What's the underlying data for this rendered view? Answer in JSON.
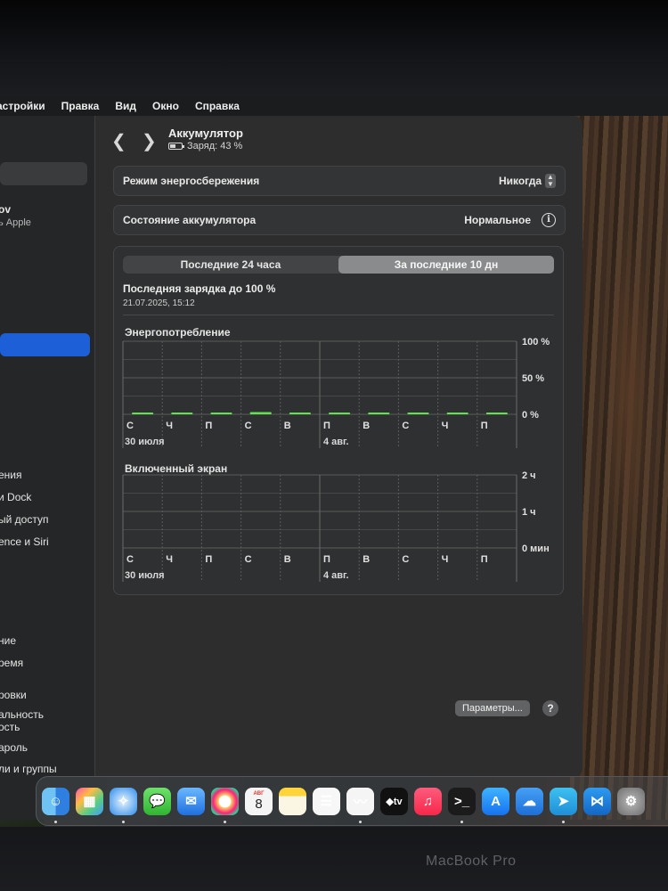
{
  "menubar": {
    "items": [
      "астройки",
      "Правка",
      "Вид",
      "Окно",
      "Справка"
    ]
  },
  "sidebar": {
    "user_name": "ov",
    "user_sub": "ь Apple",
    "items": [
      "ения",
      "и Dock",
      "ый доступ",
      "ence и Siri",
      "ние",
      "ремя",
      "ровки",
      "альность",
      "ость",
      "ароль",
      "ли и группы"
    ]
  },
  "header": {
    "title": "Аккумулятор",
    "charge": "Заряд: 43 %"
  },
  "settings": {
    "power_mode_label": "Режим энергосбережения",
    "power_mode_value": "Никогда",
    "battery_state_label": "Состояние аккумулятора",
    "battery_state_value": "Нормальное"
  },
  "panel": {
    "tabs": [
      "Последние 24 часа",
      "За последние 10 дн"
    ],
    "active_tab": 1,
    "last_charge_label": "Последняя зарядка до 100 %",
    "last_charge_date": "21.07.2025, 15:12",
    "energy_label": "Энергопотребление",
    "screen_label": "Включенный экран"
  },
  "chart_data": [
    {
      "type": "bar",
      "title": "Энергопотребление",
      "categories": [
        "С",
        "Ч",
        "П",
        "С",
        "В",
        "П",
        "В",
        "С",
        "Ч",
        "П"
      ],
      "values": [
        1,
        2,
        2,
        3,
        1,
        1,
        1,
        2,
        2,
        1
      ],
      "ylim": [
        0,
        100
      ],
      "yticks": [
        "100 %",
        "50 %",
        "0 %"
      ],
      "date_labels": [
        "30 июля",
        "4 авг."
      ],
      "bar_color": "#5fe34f"
    },
    {
      "type": "bar",
      "title": "Включенный экран",
      "categories": [
        "С",
        "Ч",
        "П",
        "С",
        "В",
        "П",
        "В",
        "С",
        "Ч",
        "П"
      ],
      "values": [
        0,
        0,
        0,
        0,
        0,
        0,
        0,
        0,
        0,
        0
      ],
      "yticks": [
        "2 ч",
        "1 ч",
        "0 мин"
      ],
      "date_labels": [
        "30 июля",
        "4 авг."
      ]
    }
  ],
  "buttons": {
    "params": "Параметры...",
    "help": "?"
  },
  "dock": {
    "apps": [
      "finder-icon",
      "launchpad-icon",
      "safari-icon",
      "messages-icon",
      "mail-icon",
      "photos-icon",
      "calendar-icon",
      "notes-icon",
      "reminders-icon",
      "freeform-icon",
      "appletv-icon",
      "music-icon",
      "terminal-icon",
      "appstore-icon",
      "weather-icon",
      "telegram-icon",
      "vscode-icon",
      "settings-icon"
    ],
    "calendar_month": "АВГ",
    "calendar_day": "8",
    "tv_label": "tv"
  },
  "device_label": "MacBook Pro"
}
